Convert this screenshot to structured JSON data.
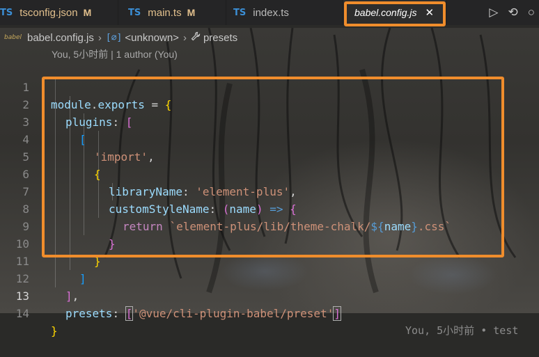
{
  "tabs": [
    {
      "lang_badge": "TS",
      "name": "tsconfig.json",
      "status": "M"
    },
    {
      "lang_badge": "TS",
      "name": "main.ts",
      "status": "M"
    },
    {
      "lang_badge": "TS",
      "name": "index.ts",
      "status": ""
    },
    {
      "lang_badge": "",
      "name": "babel.config.js",
      "status": "",
      "active": true
    }
  ],
  "editor_actions": [
    "run-icon",
    "source-control-icon",
    "circle-icon"
  ],
  "breadcrumb": {
    "file_icon_text": "babel",
    "file": "babel.config.js",
    "symbol_icon": "[⌀]",
    "symbol": "<unknown>",
    "prop_icon": "wrench-icon",
    "prop": "presets"
  },
  "blame_header": "You, 5小时前 | 1 author (You)",
  "line_numbers": [
    "1",
    "2",
    "3",
    "4",
    "5",
    "6",
    "7",
    "8",
    "9",
    "10",
    "11",
    "12",
    "13",
    "14"
  ],
  "current_line": 13,
  "code": {
    "l1": {
      "a": "module",
      "b": ".",
      "c": "exports",
      "d": " = ",
      "e": "{"
    },
    "l2": {
      "a": "plugins",
      "b": ": ",
      "c": "["
    },
    "l3": {
      "a": "["
    },
    "l4": {
      "a": "'import'",
      "b": ","
    },
    "l5": {
      "a": "{"
    },
    "l6": {
      "a": "libraryName",
      "b": ": ",
      "c": "'element-plus'",
      "d": ","
    },
    "l7": {
      "a": "customStyleName",
      "b": ": ",
      "c": "(",
      "d": "name",
      "e": ")",
      "f": " => ",
      "g": "{"
    },
    "l8": {
      "a": "return",
      "b": " ",
      "c": "`element-plus/lib/theme-chalk/",
      "d": "${",
      "e": "name",
      "f": "}",
      "g": ".css`"
    },
    "l9": {
      "a": "}"
    },
    "l10": {
      "a": "}"
    },
    "l11": {
      "a": "]"
    },
    "l12": {
      "a": "]",
      "b": ","
    },
    "l13": {
      "a": "presets",
      "b": ": ",
      "c": "[",
      "d": "'@vue/cli-plugin-babel/preset'",
      "e": "]"
    },
    "l14": {
      "a": "}"
    }
  },
  "inline_blame": "You, 5小时前 • test",
  "colors": {
    "highlight": "#f08d2c",
    "accent": "#3b8fd6"
  }
}
